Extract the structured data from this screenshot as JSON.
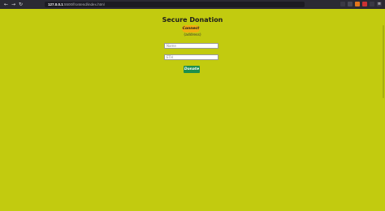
{
  "browser": {
    "url_host": "127.0.0.1",
    "url_path": ":5500/frontend/index.html",
    "back_icon": "arrow-left-icon",
    "forward_icon": "arrow-right-icon",
    "reload_icon": "reload-icon"
  },
  "page": {
    "title": "Secure Donation",
    "connect_label": "Connect",
    "address_text": "(address)",
    "name_placeholder": "Name",
    "eth_placeholder": "ETH",
    "donate_label": "Donate",
    "background_color": "#c2cb0f",
    "connect_color": "#f0ad10",
    "donate_color": "#1e8f4e"
  }
}
